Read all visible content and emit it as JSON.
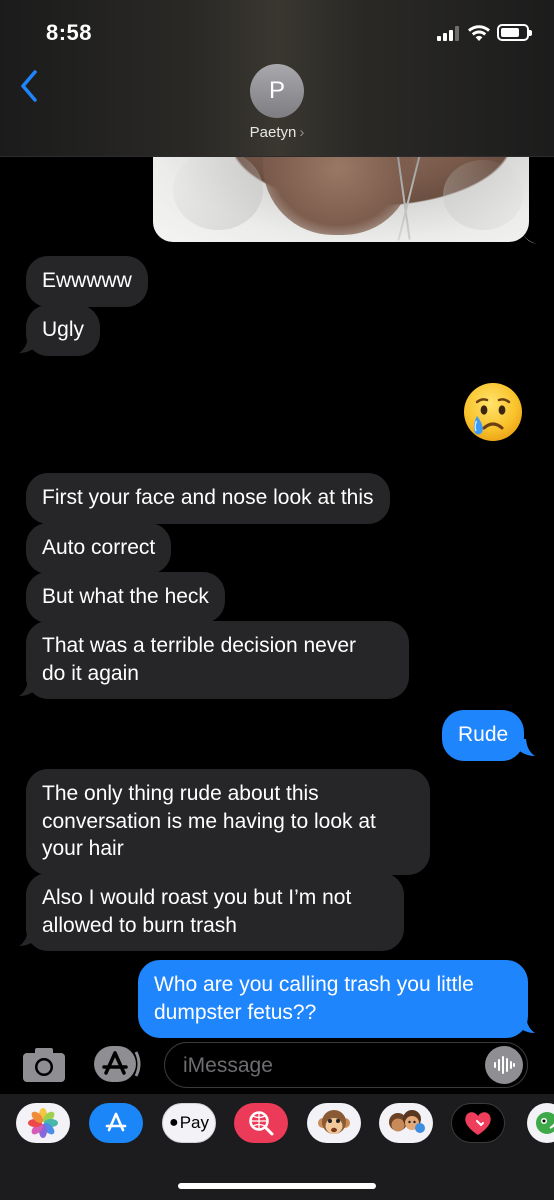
{
  "status_bar": {
    "time": "8:58"
  },
  "header": {
    "avatar_initial": "P",
    "contact_name": "Paetyn",
    "chevron": "›"
  },
  "messages": [
    {
      "id": "m1",
      "from": "them",
      "text": "Ewwwww"
    },
    {
      "id": "m2",
      "from": "them",
      "text": "Ugly"
    },
    {
      "id": "m3",
      "from": "me",
      "emoji": "crying-face"
    },
    {
      "id": "m4",
      "from": "them",
      "text": "First your face and nose look at this"
    },
    {
      "id": "m5",
      "from": "them",
      "text": "Auto correct"
    },
    {
      "id": "m6",
      "from": "them",
      "text": "But what the heck"
    },
    {
      "id": "m7",
      "from": "them",
      "lines": [
        "That was a terrible decision never",
        "do it again"
      ]
    },
    {
      "id": "m8",
      "from": "me",
      "text": "Rude"
    },
    {
      "id": "m9",
      "from": "them",
      "lines": [
        "The only thing rude about this",
        "conversation is me having to look at",
        "your hair"
      ]
    },
    {
      "id": "m10",
      "from": "them",
      "lines": [
        "Also I would roast you but I’m not",
        "allowed to burn trash"
      ]
    },
    {
      "id": "m11",
      "from": "me",
      "lines": [
        "Who are you calling trash you little",
        "dumpster fetus??"
      ]
    }
  ],
  "composer": {
    "placeholder": "iMessage"
  },
  "app_drawer": {
    "apple_pay_label": "Pay",
    "apps": [
      "photos-icon",
      "app-store-icon",
      "apple-pay-icon",
      "image-search-icon",
      "animoji-icon",
      "memoji-icon",
      "digital-touch-icon",
      "sticker-app-icon"
    ]
  },
  "colors": {
    "bubble_incoming": "#262628",
    "bubble_outgoing": "#1f85fd",
    "accent_blue": "#1a86f8"
  }
}
